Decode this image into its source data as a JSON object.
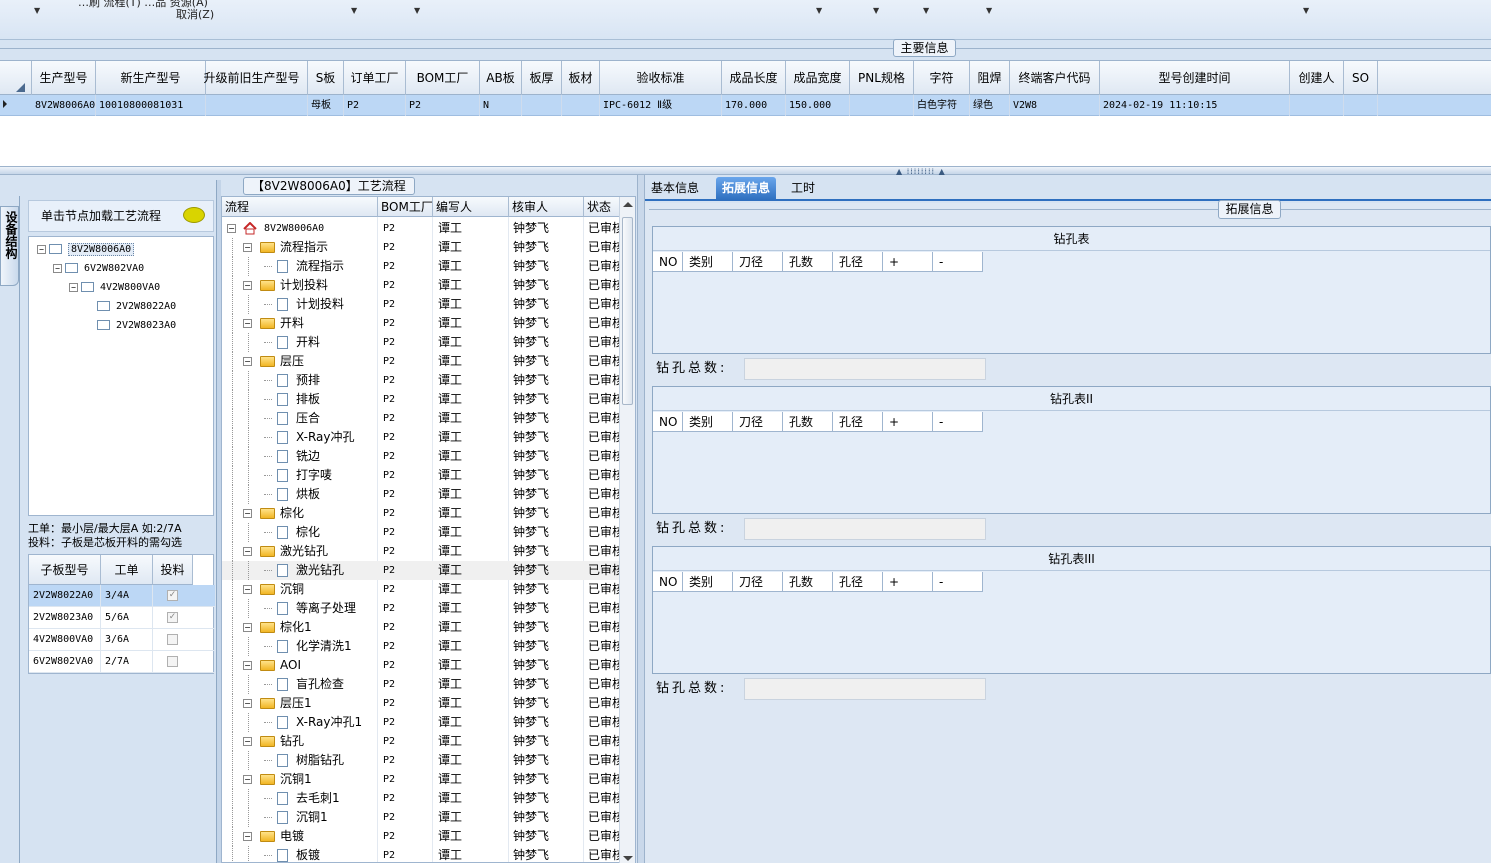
{
  "toolbar": {
    "cancel_label": "取消(Z)",
    "cut_text": "…刷 流程(T) …品 资源(A)"
  },
  "main_info": {
    "title": "主要信息",
    "columns": [
      "生产型号",
      "新生产型号",
      "升级前旧生产型号",
      "S板",
      "订单工厂",
      "BOM工厂",
      "AB板",
      "板厚",
      "板材",
      "验收标准",
      "成品长度",
      "成品宽度",
      "PNL规格",
      "字符",
      "阻焊",
      "终端客户代码",
      "型号创建时间",
      "创建人",
      "SO"
    ],
    "row": [
      "8V2W8006A0",
      "10010800081031",
      "",
      "母板",
      "P2",
      "P2",
      "N",
      "",
      "",
      "IPC-6012 Ⅱ级",
      "170.000",
      "150.000",
      "",
      "白色字符",
      "绿色",
      "V2W8",
      "2024-02-19 11:10:15",
      "",
      ""
    ]
  },
  "left": {
    "side_tab": "设备结构",
    "load_hint": "单击节点加载工艺流程",
    "tree": [
      "8V2W8006A0",
      "6V2W802VA0",
      "4V2W800VA0",
      "2V2W8022A0",
      "2V2W8023A0"
    ],
    "info_line1": "工单：最小层/最大层A 如:2/7A",
    "info_line2": "投料：子板是芯板开料的需勾选",
    "sub_headers": [
      "子板型号",
      "工单",
      "投料"
    ],
    "sub_rows": [
      {
        "model": "2V2W8022A0",
        "order": "3/4A",
        "feed": "✓"
      },
      {
        "model": "2V2W8023A0",
        "order": "5/6A",
        "feed": "✓"
      },
      {
        "model": "4V2W800VA0",
        "order": "3/6A",
        "feed": ""
      },
      {
        "model": "6V2W802VA0",
        "order": "2/7A",
        "feed": ""
      }
    ]
  },
  "flow": {
    "title": "【8V2W8006A0】工艺流程",
    "headers": [
      "流程",
      "BOM工厂",
      "编写人",
      "核审人",
      "状态"
    ],
    "root": "8V2W8006A0",
    "factory": "P2",
    "writer": "谭工",
    "reviewer": "钟梦飞",
    "status": "已审核",
    "rows": [
      {
        "level": 1,
        "name": "流程指示"
      },
      {
        "level": 2,
        "name": "流程指示"
      },
      {
        "level": 1,
        "name": "计划投料"
      },
      {
        "level": 2,
        "name": "计划投料"
      },
      {
        "level": 1,
        "name": "开料"
      },
      {
        "level": 2,
        "name": "开料"
      },
      {
        "level": 1,
        "name": "层压"
      },
      {
        "level": 2,
        "name": "预排"
      },
      {
        "level": 2,
        "name": "排板"
      },
      {
        "level": 2,
        "name": "压合"
      },
      {
        "level": 2,
        "name": "X-Ray冲孔"
      },
      {
        "level": 2,
        "name": "铣边"
      },
      {
        "level": 2,
        "name": "打字唛"
      },
      {
        "level": 2,
        "name": "烘板"
      },
      {
        "level": 1,
        "name": "棕化"
      },
      {
        "level": 2,
        "name": "棕化"
      },
      {
        "level": 1,
        "name": "激光钻孔"
      },
      {
        "level": 2,
        "name": "激光钻孔"
      },
      {
        "level": 1,
        "name": "沉铜"
      },
      {
        "level": 2,
        "name": "等离子处理"
      },
      {
        "level": 1,
        "name": "棕化1"
      },
      {
        "level": 2,
        "name": "化学清洗1"
      },
      {
        "level": 1,
        "name": "AOI"
      },
      {
        "level": 2,
        "name": "盲孔检查"
      },
      {
        "level": 1,
        "name": "层压1"
      },
      {
        "level": 2,
        "name": "X-Ray冲孔1"
      },
      {
        "level": 1,
        "name": "钻孔"
      },
      {
        "level": 2,
        "name": "树脂钻孔"
      },
      {
        "level": 1,
        "name": "沉铜1"
      },
      {
        "level": 2,
        "name": "去毛刺1"
      },
      {
        "level": 2,
        "name": "沉铜1"
      },
      {
        "level": 1,
        "name": "电镀"
      },
      {
        "level": 2,
        "name": "板镀"
      }
    ]
  },
  "right": {
    "tabs": [
      "基本信息",
      "拓展信息",
      "工时"
    ],
    "ext_title": "拓展信息",
    "drill_headers": [
      "NO",
      "类别",
      "刀径",
      "孔数",
      "孔径",
      "+",
      "-"
    ],
    "tables": [
      {
        "caption": "钻孔表",
        "total_label": "钻孔总数:"
      },
      {
        "caption": "钻孔表II",
        "total_label": "钻孔总数:"
      },
      {
        "caption": "钻孔表III",
        "total_label": "钻孔总数:"
      }
    ]
  }
}
